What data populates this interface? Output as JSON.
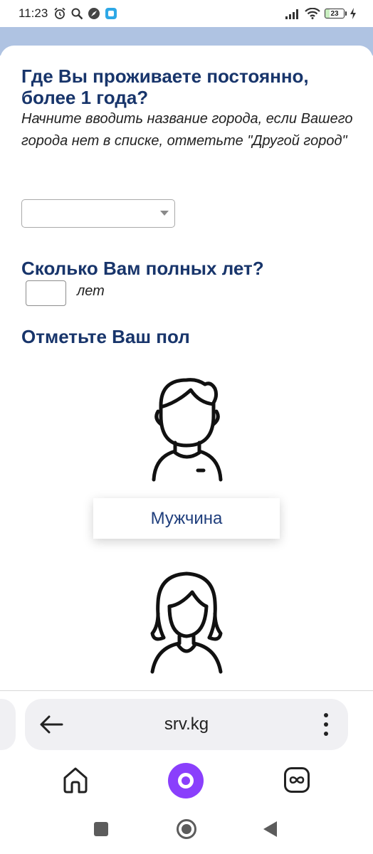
{
  "status_bar": {
    "time": "11:23",
    "battery_level": "23",
    "icons": [
      "alarm-icon",
      "search-icon",
      "compass-icon",
      "app-icon",
      "signal-icon",
      "wifi-icon",
      "battery-icon",
      "charging-icon"
    ]
  },
  "form": {
    "q1_title_line1": "Где Вы проживаете постоянно,",
    "q1_title_line2": "более 1 года?",
    "q1_hint": " Начните вводить название города, если Вашего города нет в списке, отметьте \"Другой город\"",
    "city_select_value": "",
    "q2_title": "Сколько Вам полных лет?",
    "age_value": "",
    "age_unit": "лет",
    "q3_title": "Отметьте Ваш пол",
    "gender_options": [
      {
        "label": "Мужчина",
        "icon": "male-avatar-icon"
      },
      {
        "label": "",
        "icon": "female-avatar-icon"
      }
    ]
  },
  "browser": {
    "url": "srv.kg",
    "icons": [
      "back-arrow-icon",
      "menu-dots-icon",
      "home-icon",
      "alice-icon",
      "tabs-icon"
    ]
  },
  "colors": {
    "heading": "#18356b",
    "header_strip": "#afc3e2",
    "gender_label": "#1f3e7c",
    "alice": "#8a3ffc"
  }
}
